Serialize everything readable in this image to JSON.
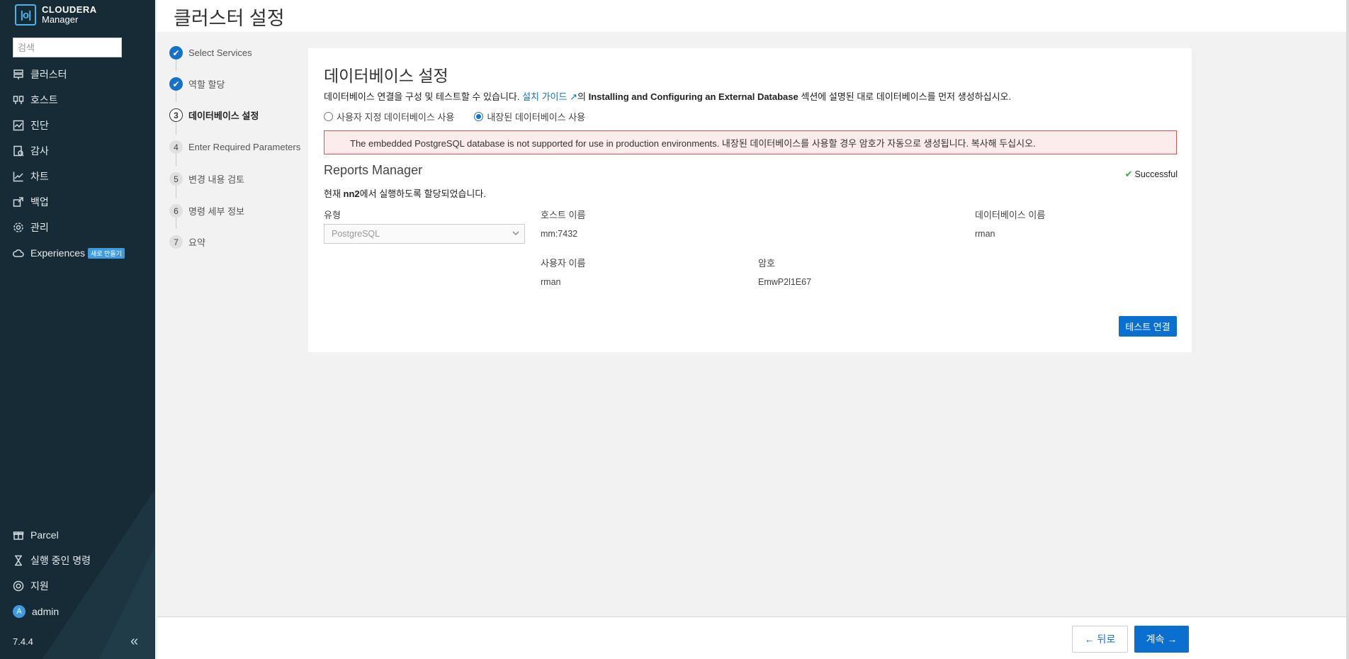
{
  "sidebar": {
    "brand_line1": "CLOUDERA",
    "brand_line2": "Manager",
    "search_placeholder": "검색",
    "nav": [
      {
        "label": "클러스터",
        "icon": "cluster-icon"
      },
      {
        "label": "호스트",
        "icon": "hosts-icon"
      },
      {
        "label": "진단",
        "icon": "diagnostics-icon"
      },
      {
        "label": "감사",
        "icon": "audit-icon"
      },
      {
        "label": "차트",
        "icon": "charts-icon"
      },
      {
        "label": "백업",
        "icon": "backup-icon"
      },
      {
        "label": "관리",
        "icon": "gear-icon"
      },
      {
        "label": "Experiences",
        "icon": "cloud-icon",
        "badge": "새로 만들기"
      }
    ],
    "bottom_nav": [
      {
        "label": "Parcel",
        "icon": "gift-icon"
      },
      {
        "label": "실행 중인 명령",
        "icon": "hourglass-icon"
      },
      {
        "label": "지원",
        "icon": "lifebuoy-icon"
      },
      {
        "label": "admin",
        "icon": "avatar",
        "avatar_letter": "A"
      }
    ],
    "version": "7.4.4"
  },
  "header": {
    "title": "클러스터 설정"
  },
  "steps": [
    {
      "num": "1",
      "label": "Select Services",
      "state": "done"
    },
    {
      "num": "2",
      "label": "역할 할당",
      "state": "done"
    },
    {
      "num": "3",
      "label": "데이터베이스 설정",
      "state": "current"
    },
    {
      "num": "4",
      "label": "Enter Required Parameters",
      "state": "todo"
    },
    {
      "num": "5",
      "label": "변경 내용 검토",
      "state": "todo"
    },
    {
      "num": "6",
      "label": "명령 세부 정보",
      "state": "todo"
    },
    {
      "num": "7",
      "label": "요약",
      "state": "todo"
    }
  ],
  "panel": {
    "title": "데이터베이스 설정",
    "intro_before": "데이터베이스 연결을 구성 및 테스트할 수 있습니다. ",
    "intro_link": "설치 가이드",
    "intro_mid": "의 ",
    "intro_bold": "Installing and Configuring an External Database",
    "intro_after": " 섹션에 설명된 대로 데이터베이스를 먼저 생성하십시오.",
    "radio_custom": "사용자 지정 데이터베이스 사용",
    "radio_embedded": "내장된 데이터베이스 사용",
    "selected_radio": "embedded",
    "alert": "The embedded PostgreSQL database is not supported for use in production environments. 내장된 데이터베이스를 사용할 경우 암호가 자동으로 생성됩니다. 복사해 두십시오.",
    "section_title": "Reports Manager",
    "status": "Successful",
    "assigned_before": "현재 ",
    "assigned_host": "nn2",
    "assigned_after": "에서 실행하도록 할당되었습니다.",
    "labels": {
      "type": "유형",
      "hostname": "호스트 이름",
      "dbname": "데이터베이스 이름",
      "username": "사용자 이름",
      "password": "암호"
    },
    "values": {
      "type": "PostgreSQL",
      "hostname": "mm:7432",
      "dbname": "rman",
      "username": "rman",
      "password": "EmwP2l1E67"
    },
    "test_button": "테스트 연결"
  },
  "footer": {
    "back": "← 뒤로",
    "next": "계속 →"
  },
  "colors": {
    "sidebar": "#162b36",
    "primary": "#0a6fcf",
    "alert_bg": "#fdecec",
    "alert_border": "#d9534f",
    "success": "#3ca64a"
  }
}
